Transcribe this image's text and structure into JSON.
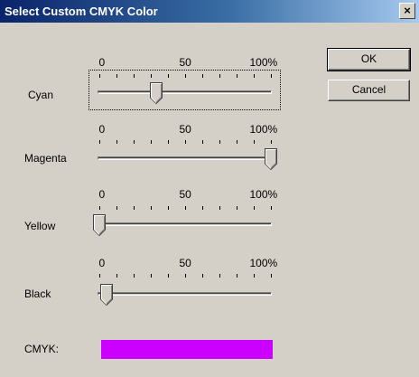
{
  "window": {
    "title": "Select Custom CMYK Color",
    "close_glyph": "×"
  },
  "buttons": {
    "ok": "OK",
    "cancel": "Cancel"
  },
  "scale": {
    "min": "0",
    "mid": "50",
    "max": "100%"
  },
  "sliders": [
    {
      "label": "Cyan",
      "value_percent": 33
    },
    {
      "label": "Magenta",
      "value_percent": 100
    },
    {
      "label": "Yellow",
      "value_percent": 0
    },
    {
      "label": "Black",
      "value_percent": 4
    }
  ],
  "result": {
    "label": "CMYK:",
    "color": "#cc00ff"
  }
}
